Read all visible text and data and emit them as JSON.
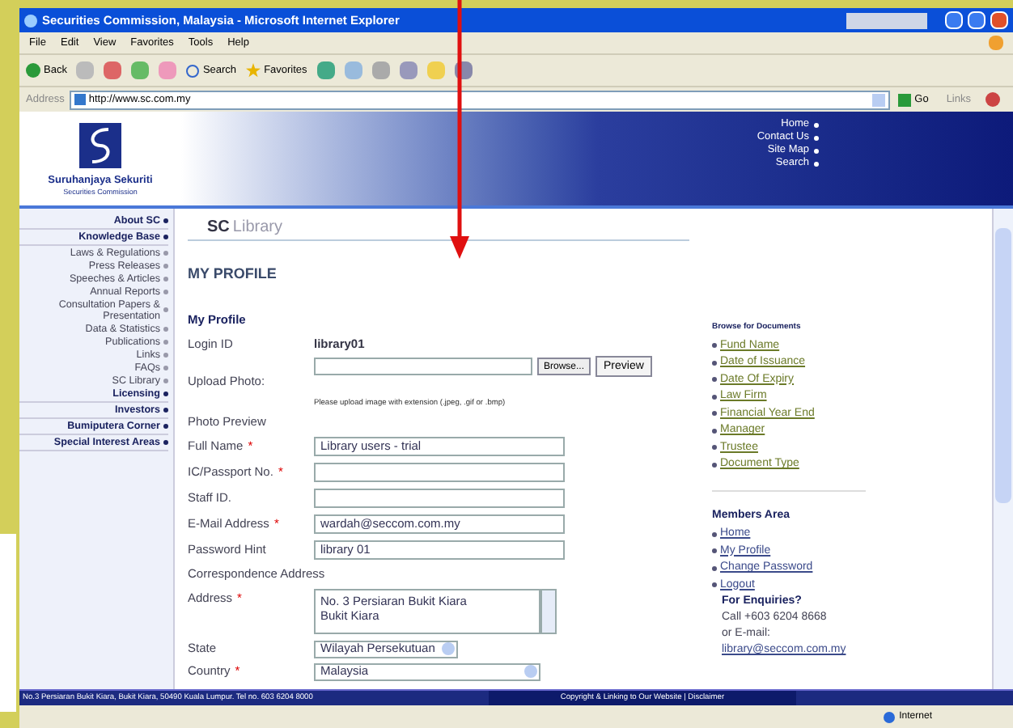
{
  "window": {
    "title": "Securities Commission, Malaysia - Microsoft Internet Explorer",
    "menu": [
      "File",
      "Edit",
      "View",
      "Favorites",
      "Tools",
      "Help"
    ],
    "toolbar": {
      "back": "Back",
      "search": "Search",
      "favorites": "Favorites"
    },
    "address": {
      "label": "Address",
      "value": "http://www.sc.com.my"
    },
    "go": "Go",
    "links": "Links"
  },
  "header": {
    "logo_name": "Suruhanjaya Sekuriti",
    "logo_sub": "Securities Commission",
    "links": [
      "Home",
      "Contact Us",
      "Site Map",
      "Search"
    ]
  },
  "sidebar": {
    "items": [
      {
        "kind": "section",
        "label": "About SC"
      },
      {
        "kind": "section",
        "label": "Knowledge Base"
      },
      {
        "kind": "item",
        "label": "Laws & Regulations"
      },
      {
        "kind": "item",
        "label": "Press Releases"
      },
      {
        "kind": "item",
        "label": "Speeches & Articles"
      },
      {
        "kind": "item",
        "label": "Annual Reports"
      },
      {
        "kind": "item",
        "label": "Consultation Papers & Presentation"
      },
      {
        "kind": "item",
        "label": "Data & Statistics"
      },
      {
        "kind": "item",
        "label": "Publications"
      },
      {
        "kind": "item",
        "label": "Links"
      },
      {
        "kind": "item",
        "label": "FAQs"
      },
      {
        "kind": "item",
        "label": "SC Library"
      },
      {
        "kind": "section",
        "label": "Licensing"
      },
      {
        "kind": "section",
        "label": "Investors"
      },
      {
        "kind": "section",
        "label": "Bumiputera Corner"
      },
      {
        "kind": "section",
        "label": "Special Interest Areas"
      }
    ]
  },
  "content": {
    "brand": {
      "bold": "SC",
      "light": "Library"
    },
    "page_title": "MY PROFILE",
    "form": {
      "heading": "My Profile",
      "rows": [
        {
          "kind": "static",
          "label": "Login ID",
          "value": "library01"
        },
        {
          "kind": "file",
          "label": "Upload Photo:",
          "browse": "Browse...",
          "preview": "Preview",
          "note": "Please upload image with extension (.jpeg, .gif or .bmp)"
        },
        {
          "kind": "label",
          "label": "Photo Preview"
        },
        {
          "kind": "input",
          "label": "Full Name",
          "required_mark": "*",
          "value": "Library users - trial"
        },
        {
          "kind": "input",
          "label": "IC/Passport No.",
          "required_mark": "*"
        },
        {
          "kind": "input",
          "label": "Staff ID."
        },
        {
          "kind": "input",
          "label": "E-Mail Address",
          "required_mark": "*",
          "value": "wardah@seccom.com.my"
        },
        {
          "kind": "input",
          "label": "Password Hint",
          "value": "library 01"
        },
        {
          "kind": "label",
          "label": "Correspondence Address"
        },
        {
          "kind": "textarea",
          "label": "Address",
          "required_mark": "*",
          "value": "No. 3 Persiaran Bukit Kiara\nBukit Kiara"
        },
        {
          "kind": "select",
          "label": "State",
          "value": "Wilayah Persekutuan"
        },
        {
          "kind": "select",
          "label": "Country",
          "required_mark": "*",
          "value": "Malaysia"
        }
      ]
    }
  },
  "right_panel": {
    "browse": {
      "title": "Browse for Documents",
      "links": [
        "Fund Name",
        "Date of Issuance",
        "Date Of Expiry",
        "Law Firm",
        "Financial Year End",
        "Manager",
        "Trustee",
        "Document Type"
      ]
    },
    "members": {
      "title": "Members Area",
      "links": [
        "Home",
        "My Profile",
        "Change Password",
        "Logout"
      ]
    },
    "enquiries": {
      "title": "For Enquiries?",
      "lines": [
        "Call +603 6204 8668",
        "or E-mail:"
      ],
      "email": "library@seccom.com.my"
    }
  },
  "footer": {
    "address": "No.3 Persiaran Bukit Kiara, Bukit Kiara, 50490 Kuala Lumpur. Tel no. 603 6204 8000",
    "links": "Copyright & Linking to Our Website | Disclaimer"
  },
  "status_bar": {
    "zone": "Internet"
  }
}
